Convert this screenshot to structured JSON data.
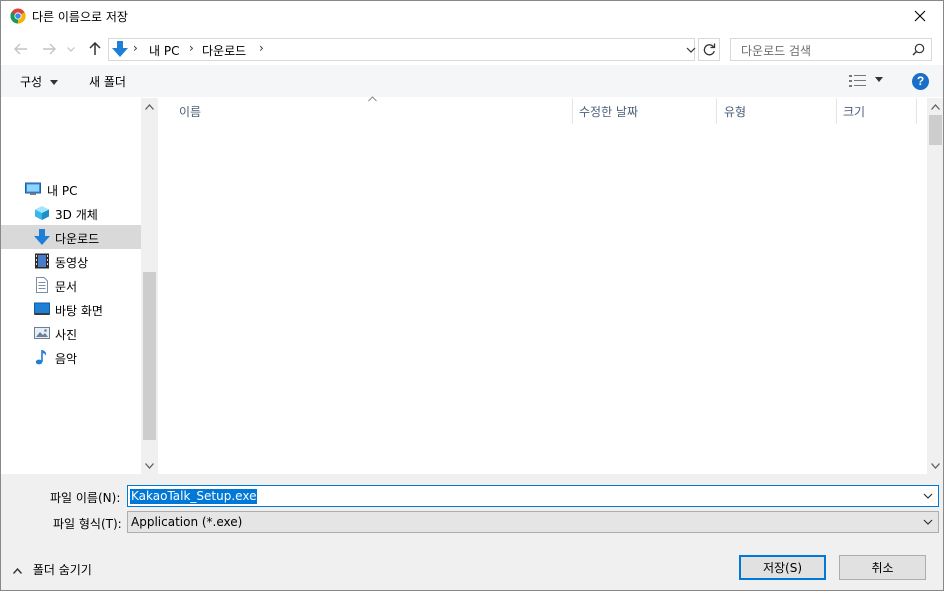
{
  "window": {
    "title": "다른 이름으로 저장",
    "close_label": "✕"
  },
  "nav": {
    "back": "←",
    "forward": "→",
    "recent": "⌄",
    "up": "↑",
    "breadcrumbs": [
      "내 PC",
      "다운로드"
    ],
    "search_placeholder": "다운로드 검색"
  },
  "toolbar": {
    "organize_label": "구성",
    "new_folder_label": "새 폴더",
    "help_label": "?"
  },
  "sidebar": {
    "items": [
      {
        "label": "내 PC",
        "icon": "computer-icon",
        "level": 0,
        "selected": false
      },
      {
        "label": "3D 개체",
        "icon": "cube-3d-icon",
        "level": 1,
        "selected": false
      },
      {
        "label": "다운로드",
        "icon": "download-arrow-icon",
        "level": 1,
        "selected": true
      },
      {
        "label": "동영상",
        "icon": "film-icon",
        "level": 1,
        "selected": false
      },
      {
        "label": "문서",
        "icon": "document-icon",
        "level": 1,
        "selected": false
      },
      {
        "label": "바탕 화면",
        "icon": "desktop-icon",
        "level": 1,
        "selected": false
      },
      {
        "label": "사진",
        "icon": "picture-icon",
        "level": 1,
        "selected": false
      },
      {
        "label": "음악",
        "icon": "music-note-icon",
        "level": 1,
        "selected": false
      }
    ]
  },
  "filelist": {
    "columns": [
      "이름",
      "수정한 날짜",
      "유형",
      "크기"
    ],
    "rows": []
  },
  "form": {
    "filename_label": "파일 이름(N):",
    "filename_value": "KakaoTalk_Setup.exe",
    "filetype_label": "파일 형식(T):",
    "filetype_value": "Application (*.exe)",
    "hide_folders_label": "폴더 숨기기",
    "save_label": "저장(S)",
    "cancel_label": "취소"
  },
  "colors": {
    "accent": "#0078d7",
    "selection": "#d9d9d9",
    "column_header": "#4c607a",
    "folder_blue": "#1e7fd6"
  }
}
